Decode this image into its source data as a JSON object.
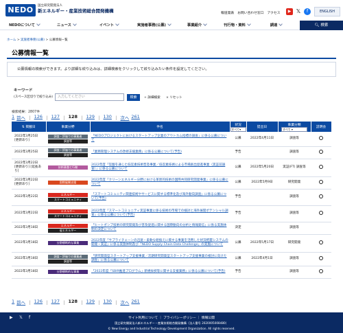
{
  "header": {
    "logo_text": "NEDO",
    "org_sub": "国立研究開発法人",
    "org_name": "新エネルギー・産業技術総合開発機構",
    "links": [
      "報道発表",
      "お問い合わせ窓口",
      "アクセス"
    ],
    "social": [
      "youtube-icon",
      "x-icon",
      "facebook-icon"
    ],
    "lang_button": "ENGLISH"
  },
  "nav": {
    "items": [
      "NEDOについて",
      "ニュース",
      "イベント",
      "実施者事務(公募)",
      "事業紹介",
      "刊行物・資料",
      "調達"
    ],
    "search_label": "検索"
  },
  "breadcrumb": {
    "home": "ホーム",
    "sep": ">",
    "parent": "実施者事務(公募)",
    "current": "公募情報一覧"
  },
  "page_title": "公募情報一覧",
  "intro": "公募情報の検索ができます。より詳細な絞り込みは、詳細検索をクリックして絞り込みたい条件を設定してください。",
  "keyword": {
    "label": "キーワード",
    "sub_label": "(スペース区切りで絞り込み)",
    "placeholder": "入力してください",
    "search_button": "検索",
    "detail_link": "+ 詳細検索",
    "reset_link": "× リセット"
  },
  "result_count": "検索結果：2807件",
  "pager_top": {
    "first": "1",
    "prev": "前へ",
    "pages": [
      "126",
      "127",
      "128",
      "129",
      "130"
    ],
    "current": "128",
    "next": "次へ",
    "last": "261"
  },
  "pager_bottom": {
    "first": "1",
    "prev": "前へ",
    "pages": [
      "126",
      "127",
      "128",
      "129",
      "130"
    ],
    "current": "128",
    "next": "次へ",
    "last": "261"
  },
  "table": {
    "columns": [
      "掲載日",
      "事業分野",
      "件名",
      "状況",
      "提出日",
      "事業分類",
      "説明会"
    ],
    "status_filter": "すべて",
    "class_filter": "すべて",
    "rows": [
      {
        "date": "2022年3月25日",
        "note": "[更新あり]",
        "cats": [
          {
            "label": "調査・評価での事業者",
            "color": "#5b6b78"
          },
          {
            "label": "調査等",
            "color": "#222222"
          }
        ],
        "title": "「NEDOプロジェクトにおけるスタートアップ企業のアウトカム指標の調査」に係る公募について",
        "status": "公募",
        "submit": "2022年4月11日",
        "cls": "調査等",
        "briefing": "○"
      },
      {
        "date": "2022年3月25日",
        "note": "",
        "cats": [
          {
            "label": "調査・評価での事業者",
            "color": "#5b6b78"
          },
          {
            "label": "調査等",
            "color": "#222222"
          }
        ],
        "title": "「業務管理システムの改修支援業務」に係る公募について(予告)",
        "status": "予告",
        "submit": "",
        "cls": "調査等",
        "briefing": "○"
      },
      {
        "date": "2022年3月22日",
        "note": "[更新あり] [延長あり]",
        "cats": [
          {
            "label": "技術基盤と行動",
            "color": "#b35a9e"
          }
        ],
        "title": "2022年度「炭酸を通じた低炭素技術普及事業／低炭素技術による市場創出促進事業（実証前調査）」に係る公募について",
        "status": "公募",
        "submit": "2022年5月20日",
        "cls": "実証(FT) 調査等",
        "briefing": "○"
      },
      {
        "date": "2022年3月22日",
        "note": "[更新あり]",
        "cats": [
          {
            "label": "国際展開支援",
            "color": "#d9481f"
          }
        ],
        "title": "2022年度「クリーンエネルギー分野における革新的技術の国際共同研究開発事業」に係る公募について",
        "status": "公募",
        "submit": "2022年5月9日",
        "cls": "研究開発",
        "briefing": "○"
      },
      {
        "date": "2022年3月22日",
        "note": "",
        "cats": [
          {
            "label": "エネルギー",
            "color": "#d9281f"
          },
          {
            "label": "スマートコミュニティ",
            "color": "#222222"
          }
        ],
        "title": "「スマートコミュニティ関連技術やサービスに関する標準化及び海外動向調査」に係る公募について(予告)",
        "status": "予告",
        "submit": "",
        "cls": "調査等",
        "briefing": "○"
      },
      {
        "date": "2022年3月22日",
        "note": "",
        "cats": [
          {
            "label": "エネルギー",
            "color": "#d9281f"
          },
          {
            "label": "スマートコミュニティ",
            "color": "#222222"
          }
        ],
        "title": "2022年度「スマートコミュニティ実証事業に係る技術の市場での検討と海外展開ポテンシャル調査」に係る公募について(予告)",
        "status": "予告",
        "submit": "",
        "cls": "調査等",
        "briefing": "○"
      },
      {
        "date": "2022年3月18日",
        "note": "",
        "cats": [
          {
            "label": "エネルギー",
            "color": "#d9281f"
          },
          {
            "label": "省エネルギー",
            "color": "#222222"
          }
        ],
        "title": "「ヒートポンプ技術の研究開発及び普及促進に関する国際動向の分析と情報発信」に係る実施体制の決定について",
        "status": "決定",
        "submit": "",
        "cls": "調査等",
        "briefing": ""
      },
      {
        "date": "2022年3月18日",
        "note": "",
        "cats": [
          {
            "label": "分野横断的な事業",
            "color": "#4a2a7a"
          }
        ],
        "title": "2022年度「サプライチェーンの迅速・柔軟な組換えに資する事業を活用した状況把握システムの開発・実証」に係る実施体制及び「NEDO Supply Chain Data Challenge」の実施について",
        "status": "公募",
        "submit": "2022年5月17日",
        "cls": "研究開発",
        "briefing": "○"
      },
      {
        "date": "2022年3月18日",
        "note": "",
        "cats": [
          {
            "label": "調査・評価での事業者",
            "color": "#5b6b78"
          },
          {
            "label": "調査等",
            "color": "#222222"
          }
        ],
        "title": "「研究開発型スタートアップ支援事業／次期研究開発型スタートアップ支援事業の検討に向けた調査」に係る公募について",
        "status": "公募",
        "submit": "2022年4月1日",
        "cls": "調査等",
        "briefing": "○"
      },
      {
        "date": "2022年3月18日",
        "note": "",
        "cats": [
          {
            "label": "分野横断的な事業",
            "color": "#4a2a7a"
          }
        ],
        "title": "「2022年度「SBIR推進プログラム」新規採択等に関する支援業務」に係る公募について(予告)",
        "status": "予告",
        "submit": "",
        "cls": "調査等",
        "briefing": "○"
      }
    ]
  },
  "footer": {
    "links": "サイト利用について ｜ プライバシーポリシー ｜ 情報公開",
    "address": "国立研究開発法人新エネルギー・産業技術総合開発機構（法人番号 2020005008480）",
    "copyright": "© New Energy and Industrial Technology Development Organization. All rights reserved."
  },
  "colors": {
    "brand": "#0b4aa2",
    "navy": "#0b2a63",
    "link": "#1f5fb5"
  }
}
